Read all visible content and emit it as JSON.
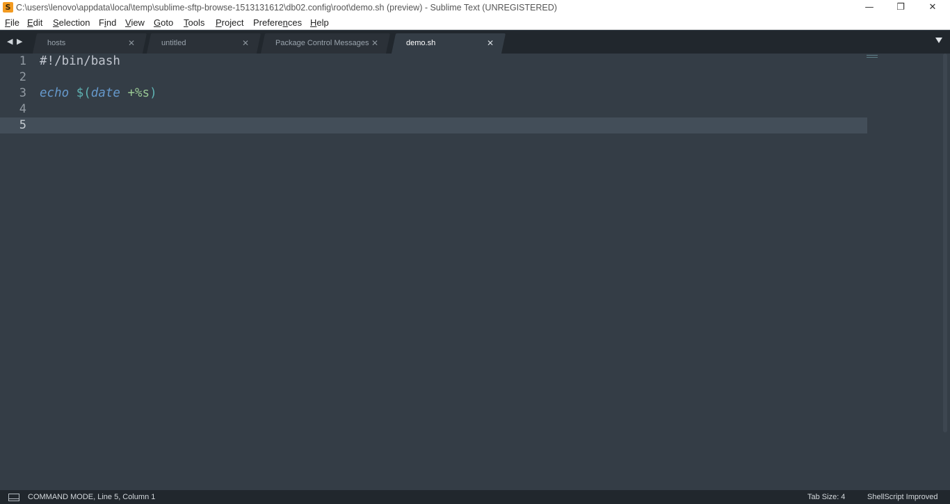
{
  "window": {
    "icon_glyph": "S",
    "title": "C:\\users\\lenovo\\appdata\\local\\temp\\sublime-sftp-browse-1513131612\\db02.config\\root\\demo.sh (preview) - Sublime Text (UNREGISTERED)",
    "minimize_glyph": "—",
    "restore_glyph": "❐",
    "close_glyph": "✕"
  },
  "menu": [
    {
      "key": "F",
      "rest": "ile"
    },
    {
      "key": "E",
      "rest": "dit"
    },
    {
      "key": "S",
      "rest": "election"
    },
    {
      "key": "",
      "pre": "F",
      "key2": "i",
      "rest": "nd"
    },
    {
      "key": "V",
      "rest": "iew"
    },
    {
      "key": "G",
      "rest": "oto"
    },
    {
      "key": "T",
      "rest": "ools"
    },
    {
      "key": "P",
      "rest": "roject"
    },
    {
      "key": "",
      "pre": "Prefere",
      "key2": "n",
      "rest": "ces"
    },
    {
      "key": "H",
      "rest": "elp"
    }
  ],
  "tabs": {
    "back_glyph": "◀",
    "forward_glyph": "▶",
    "close_glyph": "✕",
    "items": [
      {
        "label": "hosts",
        "active": false
      },
      {
        "label": "untitled",
        "active": false
      },
      {
        "label": "Package Control Messages",
        "active": false
      },
      {
        "label": "demo.sh",
        "active": true
      }
    ]
  },
  "editor": {
    "lines": [
      {
        "num": "1",
        "tokens": [
          {
            "t": "plain",
            "v": "#!/bin/bash"
          }
        ]
      },
      {
        "num": "2",
        "tokens": []
      },
      {
        "num": "3",
        "tokens": [
          {
            "t": "kw",
            "v": "echo"
          },
          {
            "t": "plain",
            "v": " "
          },
          {
            "t": "var",
            "v": "$("
          },
          {
            "t": "kw",
            "v": "date"
          },
          {
            "t": "plain",
            "v": " "
          },
          {
            "t": "str",
            "v": "+%s"
          },
          {
            "t": "var",
            "v": ")"
          }
        ]
      },
      {
        "num": "4",
        "tokens": []
      },
      {
        "num": "5",
        "tokens": [],
        "current": true
      }
    ],
    "colors": {
      "background": "#343d46",
      "current_line": "#434e59",
      "keyword": "#6699cc",
      "variable": "#5fb3b3",
      "string": "#99c794",
      "text": "#c0c5ce"
    }
  },
  "status": {
    "mode": "COMMAND MODE, Line 5, Column 1",
    "tab_size": "Tab Size: 4",
    "syntax": "ShellScript Improved"
  }
}
